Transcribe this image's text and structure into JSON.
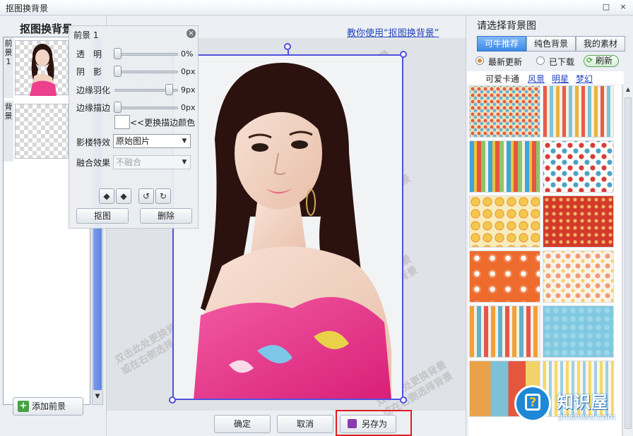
{
  "window": {
    "title": "抠图换背景",
    "restore_glyph": "□",
    "close_glyph": "×"
  },
  "left": {
    "heading": "抠图换背景",
    "layers": [
      {
        "tab": "前景1",
        "label": "前景 1"
      },
      {
        "tab": "背景",
        "label": "背景"
      }
    ],
    "add_foreground_label": "添加前景"
  },
  "fg_panel": {
    "title": "前景 1",
    "opacity": {
      "label": "透　明",
      "value": "0%",
      "level": 0
    },
    "shadow": {
      "label": "阴　影",
      "value": "0px",
      "level": 0
    },
    "feather": {
      "label": "边缘羽化",
      "value": "9px",
      "level": 0.9
    },
    "stroke": {
      "label": "边缘描边",
      "value": "0px",
      "level": 0
    },
    "change_stroke_color_label": "<<更换描边颜色",
    "effect": {
      "label": "影楼特效",
      "value": "原始图片"
    },
    "blend": {
      "label": "融合效果",
      "value": "不融合"
    },
    "cutout_label": "抠图",
    "delete_label": "删除"
  },
  "center": {
    "help_link": "教你使用“抠图换背景”",
    "watermark_line1": "双击此处更换背景",
    "watermark_line2": "或在右侧选择背景",
    "ok_label": "确定",
    "cancel_label": "取消",
    "saveas_label": "另存为"
  },
  "right": {
    "heading": "请选择背景图",
    "tabs": [
      "可牛推荐",
      "纯色背景",
      "我的素材"
    ],
    "active_tab": 0,
    "filters": {
      "latest": "最新更新",
      "downloaded": "已下载",
      "refresh": "刷新"
    },
    "categories": [
      "可爱卡通",
      "风景",
      "明星",
      "梦幻"
    ]
  },
  "brand": {
    "name": "知识屋",
    "url": "zhishiwu.com"
  },
  "colors": {
    "selection": "#5050e0",
    "highlight": "#e02020",
    "tab_active": "#3c8ae8",
    "link": "#2244bb"
  }
}
